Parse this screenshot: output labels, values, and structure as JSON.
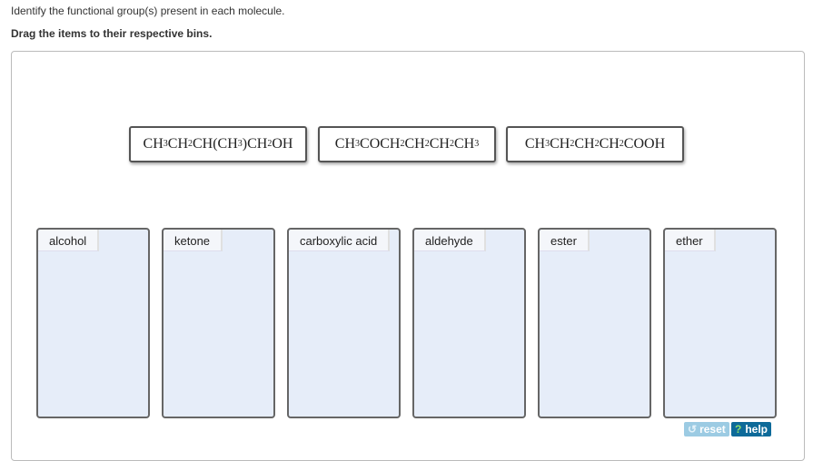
{
  "instruction": "Identify the functional group(s) present in each molecule.",
  "subinstruction": "Drag the items to their respective bins.",
  "molecules": [
    [
      [
        "CH",
        ""
      ],
      [
        "",
        "3"
      ],
      [
        "CH",
        ""
      ],
      [
        "",
        "2"
      ],
      [
        "CH(CH",
        ""
      ],
      [
        "",
        "3"
      ],
      [
        ")CH",
        ""
      ],
      [
        "",
        "2"
      ],
      [
        "OH",
        ""
      ]
    ],
    [
      [
        "CH",
        ""
      ],
      [
        "",
        "3"
      ],
      [
        "COCH",
        ""
      ],
      [
        "",
        "2"
      ],
      [
        "CH",
        ""
      ],
      [
        "",
        "2"
      ],
      [
        "CH",
        ""
      ],
      [
        "",
        "2"
      ],
      [
        "CH",
        ""
      ],
      [
        "",
        "3"
      ]
    ],
    [
      [
        "CH",
        ""
      ],
      [
        "",
        "3"
      ],
      [
        "CH",
        ""
      ],
      [
        "",
        "2"
      ],
      [
        "CH",
        ""
      ],
      [
        "",
        "2"
      ],
      [
        "CH",
        ""
      ],
      [
        "",
        "2"
      ],
      [
        "COOH",
        ""
      ]
    ]
  ],
  "bins": [
    "alcohol",
    "ketone",
    "carboxylic acid",
    "aldehyde",
    "ester",
    "ether"
  ],
  "buttons": {
    "reset": "reset",
    "help": "help",
    "reset_icon": "↺",
    "help_icon": "?"
  }
}
